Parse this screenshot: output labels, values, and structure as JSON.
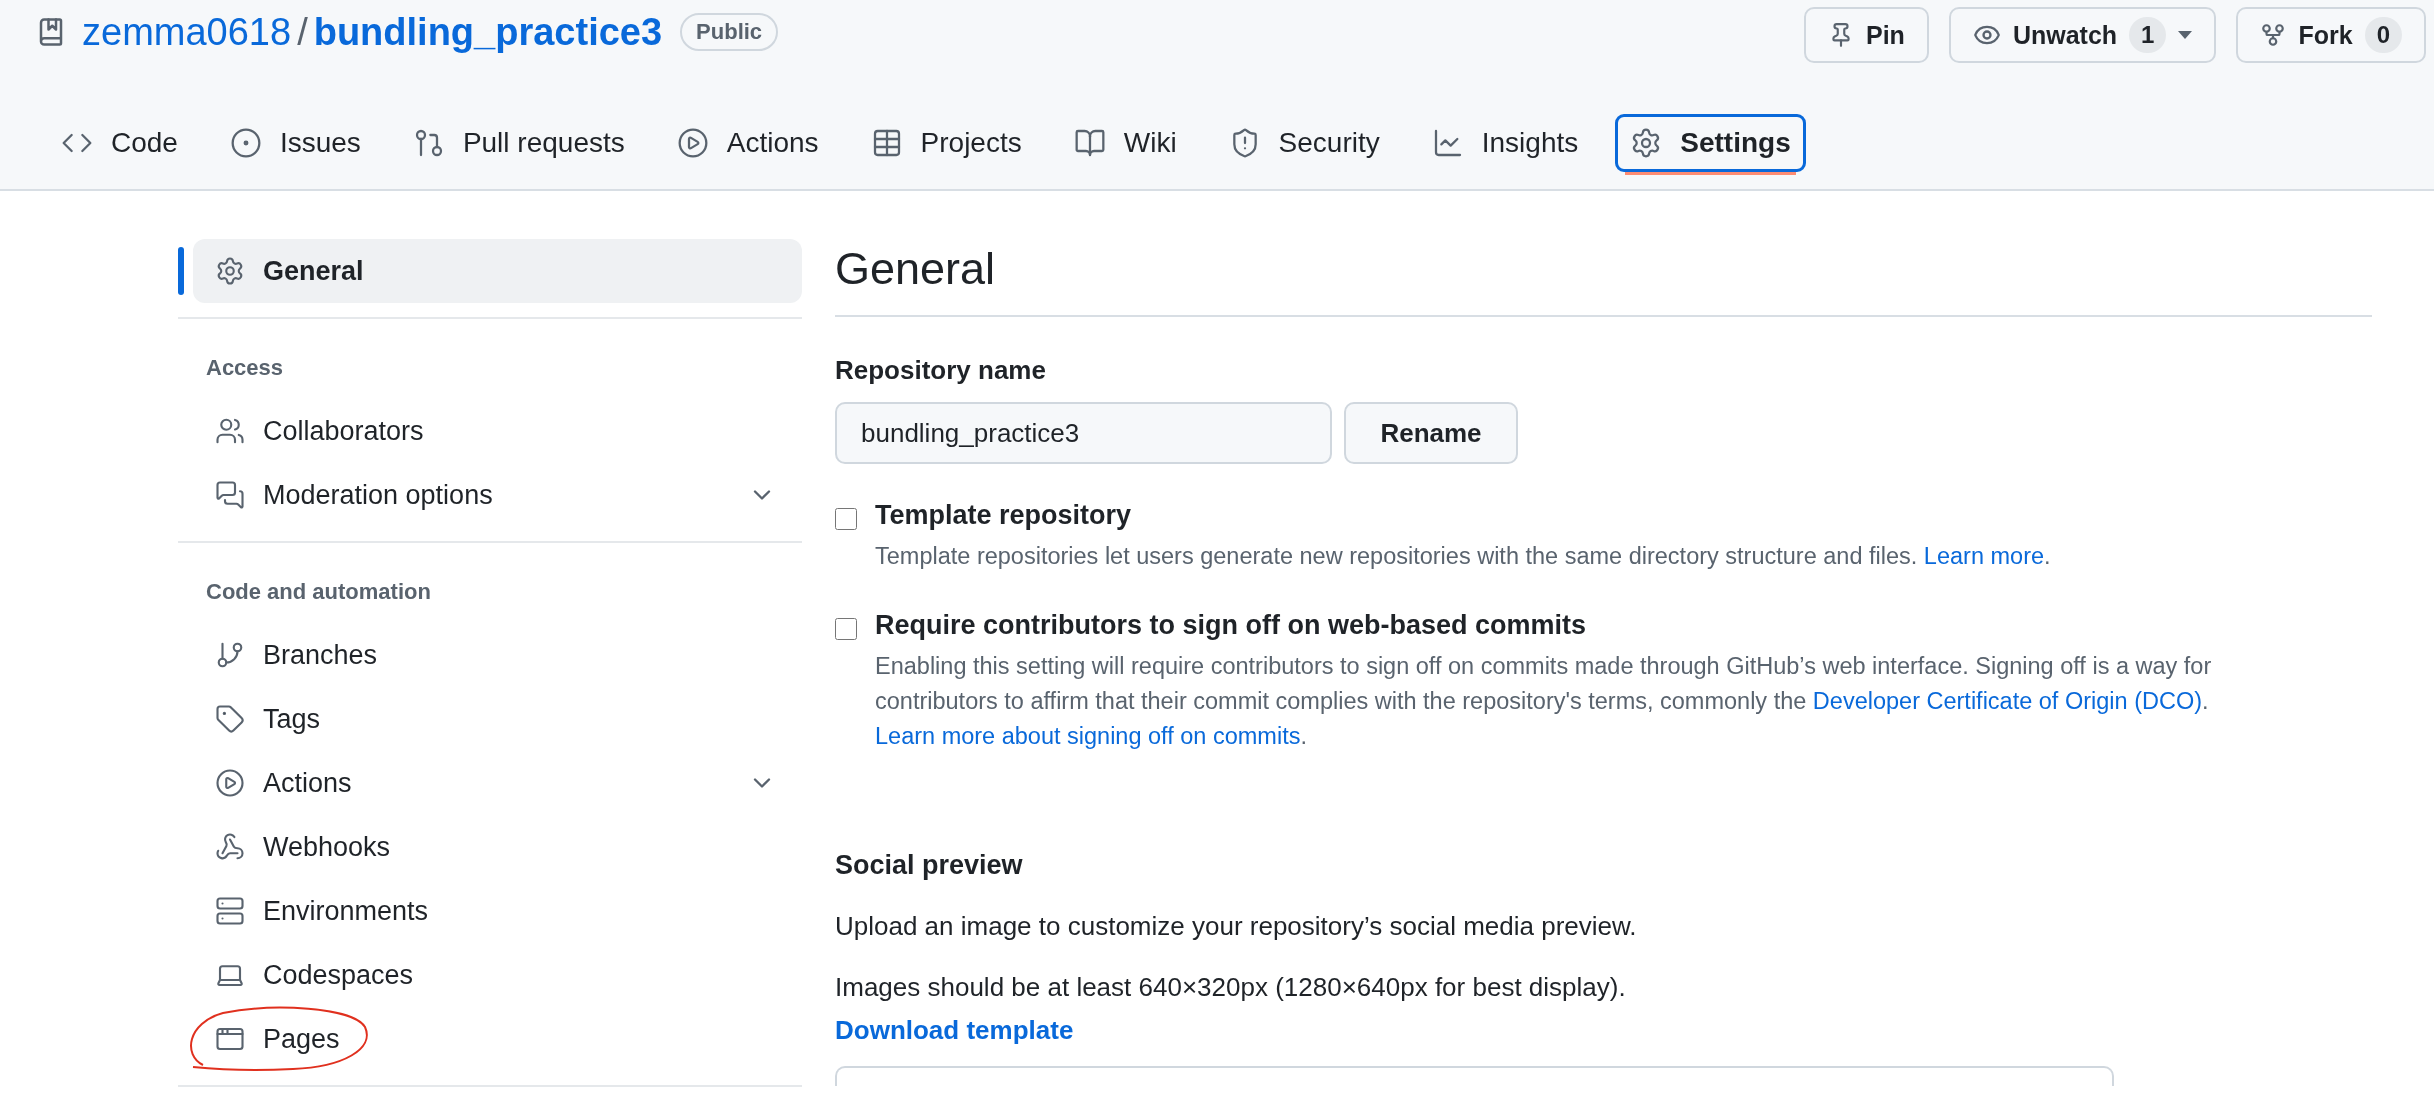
{
  "repo": {
    "owner": "zemma0618",
    "separator": "/",
    "name": "bundling_practice3",
    "visibility": "Public"
  },
  "header_buttons": [
    {
      "kind": "pin",
      "label": "Pin"
    },
    {
      "kind": "watch",
      "label": "Unwatch",
      "count": "1"
    },
    {
      "kind": "fork",
      "label": "Fork",
      "count": "0"
    }
  ],
  "tabs": [
    {
      "kind": "code",
      "label": "Code",
      "selected": false
    },
    {
      "kind": "issues",
      "label": "Issues",
      "selected": false
    },
    {
      "kind": "pull",
      "label": "Pull requests",
      "selected": false
    },
    {
      "kind": "play",
      "label": "Actions",
      "selected": false
    },
    {
      "kind": "table",
      "label": "Projects",
      "selected": false
    },
    {
      "kind": "book",
      "label": "Wiki",
      "selected": false
    },
    {
      "kind": "shield",
      "label": "Security",
      "selected": false
    },
    {
      "kind": "graph",
      "label": "Insights",
      "selected": false
    },
    {
      "kind": "gear",
      "label": "Settings",
      "selected": true
    }
  ],
  "sidebar": [
    {
      "items": [
        {
          "kind": "gear",
          "label": "General",
          "selected": true,
          "expandable": false,
          "circled": false
        }
      ]
    },
    {
      "heading": "Access",
      "items": [
        {
          "kind": "people",
          "label": "Collaborators",
          "selected": false,
          "expandable": false,
          "circled": false
        },
        {
          "kind": "comments",
          "label": "Moderation options",
          "selected": false,
          "expandable": true,
          "circled": false
        }
      ]
    },
    {
      "heading": "Code and automation",
      "items": [
        {
          "kind": "branch",
          "label": "Branches",
          "selected": false,
          "expandable": false,
          "circled": false
        },
        {
          "kind": "tag",
          "label": "Tags",
          "selected": false,
          "expandable": false,
          "circled": false
        },
        {
          "kind": "play",
          "label": "Actions",
          "selected": false,
          "expandable": true,
          "circled": false
        },
        {
          "kind": "webhook",
          "label": "Webhooks",
          "selected": false,
          "expandable": false,
          "circled": false
        },
        {
          "kind": "server",
          "label": "Environments",
          "selected": false,
          "expandable": false,
          "circled": false
        },
        {
          "kind": "codespace",
          "label": "Codespaces",
          "selected": false,
          "expandable": false,
          "circled": false
        },
        {
          "kind": "window",
          "label": "Pages",
          "selected": false,
          "expandable": false,
          "circled": true
        }
      ]
    }
  ],
  "main": {
    "title": "General",
    "repo_name": {
      "label": "Repository name",
      "value": "bundling_practice3",
      "button": "Rename"
    },
    "options": [
      {
        "label": "Template repository",
        "checked": false,
        "description": [
          {
            "kind": "text",
            "text": "Template repositories let users generate new repositories with the same directory structure and files. "
          },
          {
            "kind": "link",
            "text": "Learn more"
          },
          {
            "kind": "text",
            "text": "."
          }
        ]
      },
      {
        "label": "Require contributors to sign off on web-based commits",
        "checked": false,
        "description": [
          {
            "kind": "text",
            "text": "Enabling this setting will require contributors to sign off on commits made through GitHub’s web interface. Signing off is a way for contributors to affirm that their commit complies with the repository's terms, commonly the "
          },
          {
            "kind": "link",
            "text": "Developer Certificate of Origin (DCO)"
          },
          {
            "kind": "text",
            "text": ". "
          },
          {
            "kind": "link",
            "text": "Learn more about signing off on commits"
          },
          {
            "kind": "text",
            "text": "."
          }
        ]
      }
    ],
    "social_preview": {
      "title": "Social preview",
      "lines": [
        "Upload an image to customize your repository’s social media preview.",
        "Images should be at least 640×320px (1280×640px for best display)."
      ],
      "link": "Download template"
    }
  }
}
